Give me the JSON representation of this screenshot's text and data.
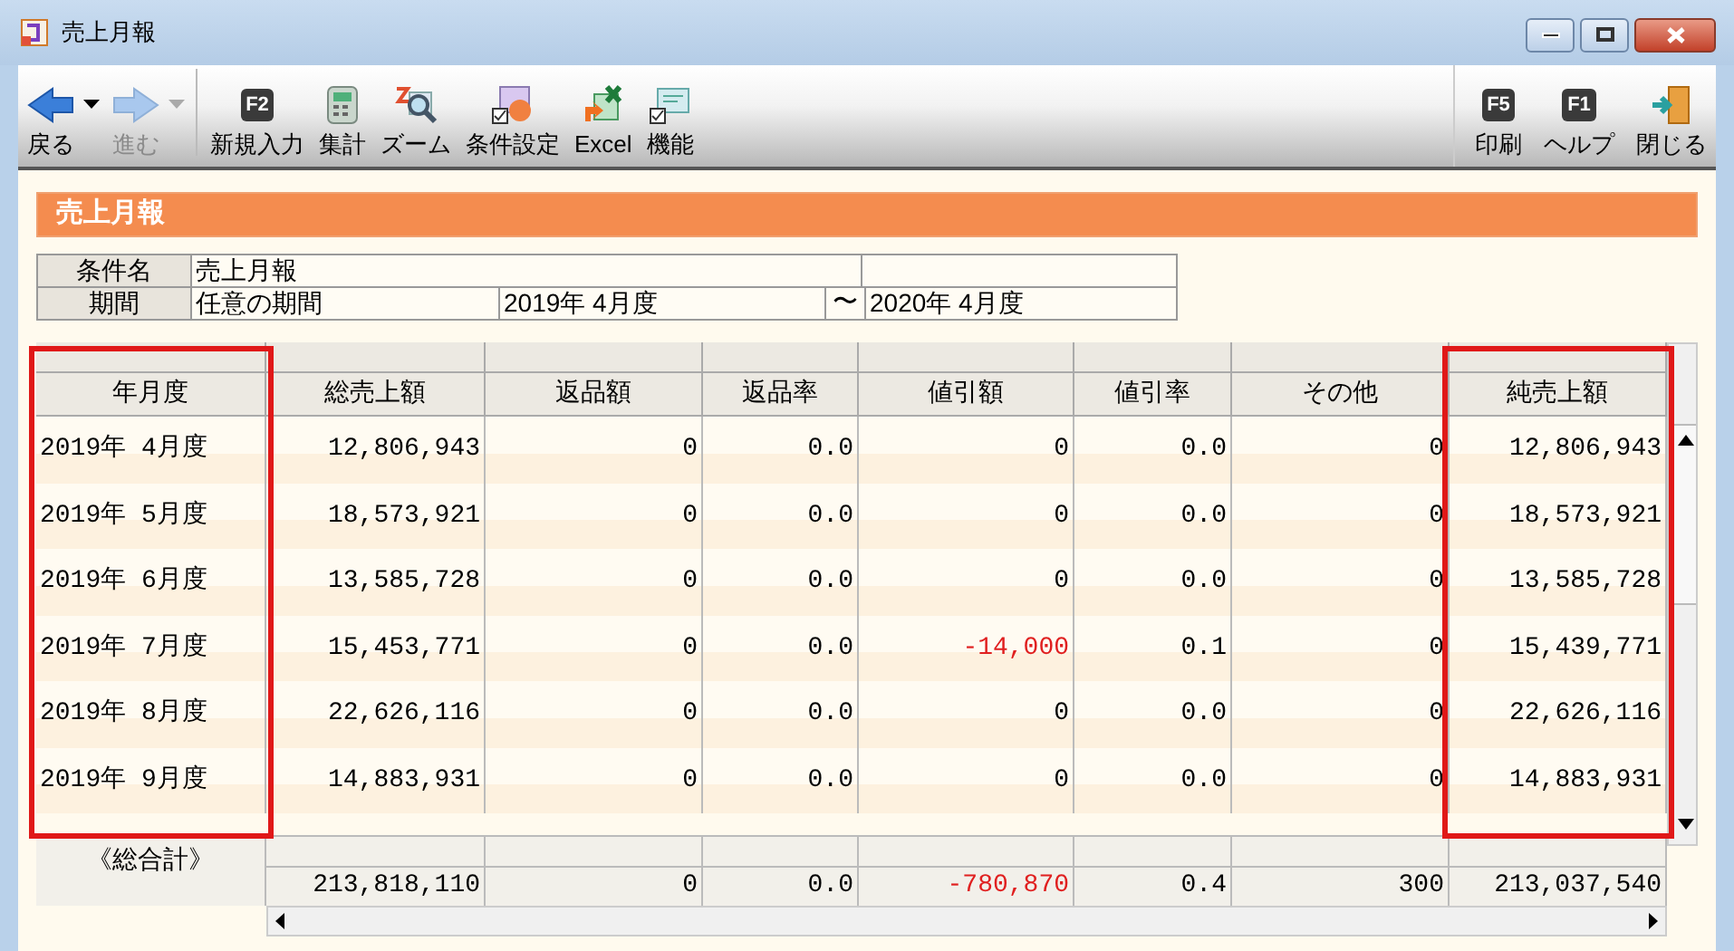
{
  "window": {
    "title": "売上月報"
  },
  "toolbar": {
    "left": [
      {
        "label": "戻る",
        "kind": "back",
        "disabled": false,
        "dropdown": true
      },
      {
        "label": "進む",
        "kind": "forward",
        "disabled": true,
        "dropdown": true
      },
      {
        "label": "新規入力",
        "kind": "key",
        "key": "F2",
        "disabled": false,
        "dropdown": false
      },
      {
        "label": "集計",
        "kind": "calculator",
        "disabled": false,
        "dropdown": false
      },
      {
        "label": "ズーム",
        "kind": "zoom",
        "disabled": false,
        "dropdown": false
      },
      {
        "label": "条件設定",
        "kind": "settings",
        "disabled": false,
        "dropdown": false
      },
      {
        "label": "Excel",
        "kind": "excel",
        "disabled": false,
        "dropdown": false
      },
      {
        "label": "機能",
        "kind": "function",
        "disabled": false,
        "dropdown": false
      }
    ],
    "right": [
      {
        "label": "印刷",
        "kind": "key",
        "key": "F5",
        "disabled": false,
        "dropdown": false
      },
      {
        "label": "ヘルプ",
        "kind": "key",
        "key": "F1",
        "disabled": false,
        "dropdown": false
      },
      {
        "label": "閉じる",
        "kind": "exit",
        "disabled": false,
        "dropdown": false
      }
    ]
  },
  "section_title": "売上月報",
  "conditions": {
    "name_label": "条件名",
    "name_value": "売上月報",
    "period_label": "期間",
    "period_type": "任意の期間",
    "period_from": "2019年 4月度",
    "separator": "〜",
    "period_to": "2020年 4月度"
  },
  "table": {
    "columns": [
      {
        "label": "年月度",
        "highlighted": true
      },
      {
        "label": "総売上額",
        "highlighted": false
      },
      {
        "label": "返品額",
        "highlighted": false
      },
      {
        "label": "返品率",
        "highlighted": false
      },
      {
        "label": "値引額",
        "highlighted": false
      },
      {
        "label": "値引率",
        "highlighted": false
      },
      {
        "label": "その他",
        "highlighted": false
      },
      {
        "label": "純売上額",
        "highlighted": true
      }
    ],
    "rows": [
      [
        {
          "text": "2019年 4月度",
          "negative": false
        },
        {
          "text": "12,806,943",
          "negative": false
        },
        {
          "text": "0",
          "negative": false
        },
        {
          "text": "0.0",
          "negative": false
        },
        {
          "text": "0",
          "negative": false
        },
        {
          "text": "0.0",
          "negative": false
        },
        {
          "text": "0",
          "negative": false
        },
        {
          "text": "12,806,943",
          "negative": false
        }
      ],
      [
        {
          "text": "2019年 5月度",
          "negative": false
        },
        {
          "text": "18,573,921",
          "negative": false
        },
        {
          "text": "0",
          "negative": false
        },
        {
          "text": "0.0",
          "negative": false
        },
        {
          "text": "0",
          "negative": false
        },
        {
          "text": "0.0",
          "negative": false
        },
        {
          "text": "0",
          "negative": false
        },
        {
          "text": "18,573,921",
          "negative": false
        }
      ],
      [
        {
          "text": "2019年 6月度",
          "negative": false
        },
        {
          "text": "13,585,728",
          "negative": false
        },
        {
          "text": "0",
          "negative": false
        },
        {
          "text": "0.0",
          "negative": false
        },
        {
          "text": "0",
          "negative": false
        },
        {
          "text": "0.0",
          "negative": false
        },
        {
          "text": "0",
          "negative": false
        },
        {
          "text": "13,585,728",
          "negative": false
        }
      ],
      [
        {
          "text": "2019年 7月度",
          "negative": false
        },
        {
          "text": "15,453,771",
          "negative": false
        },
        {
          "text": "0",
          "negative": false
        },
        {
          "text": "0.0",
          "negative": false
        },
        {
          "text": "-14,000",
          "negative": true
        },
        {
          "text": "0.1",
          "negative": false
        },
        {
          "text": "0",
          "negative": false
        },
        {
          "text": "15,439,771",
          "negative": false
        }
      ],
      [
        {
          "text": "2019年 8月度",
          "negative": false
        },
        {
          "text": "22,626,116",
          "negative": false
        },
        {
          "text": "0",
          "negative": false
        },
        {
          "text": "0.0",
          "negative": false
        },
        {
          "text": "0",
          "negative": false
        },
        {
          "text": "0.0",
          "negative": false
        },
        {
          "text": "0",
          "negative": false
        },
        {
          "text": "22,626,116",
          "negative": false
        }
      ],
      [
        {
          "text": "2019年 9月度",
          "negative": false
        },
        {
          "text": "14,883,931",
          "negative": false
        },
        {
          "text": "0",
          "negative": false
        },
        {
          "text": "0.0",
          "negative": false
        },
        {
          "text": "0",
          "negative": false
        },
        {
          "text": "0.0",
          "negative": false
        },
        {
          "text": "0",
          "negative": false
        },
        {
          "text": "14,883,931",
          "negative": false
        }
      ]
    ],
    "total": {
      "label": "《総合計》",
      "cells": [
        {
          "text": "213,818,110",
          "negative": false
        },
        {
          "text": "0",
          "negative": false
        },
        {
          "text": "0.0",
          "negative": false
        },
        {
          "text": "-780,870",
          "negative": true
        },
        {
          "text": "0.4",
          "negative": false
        },
        {
          "text": "300",
          "negative": false
        },
        {
          "text": "213,037,540",
          "negative": false
        }
      ]
    }
  }
}
